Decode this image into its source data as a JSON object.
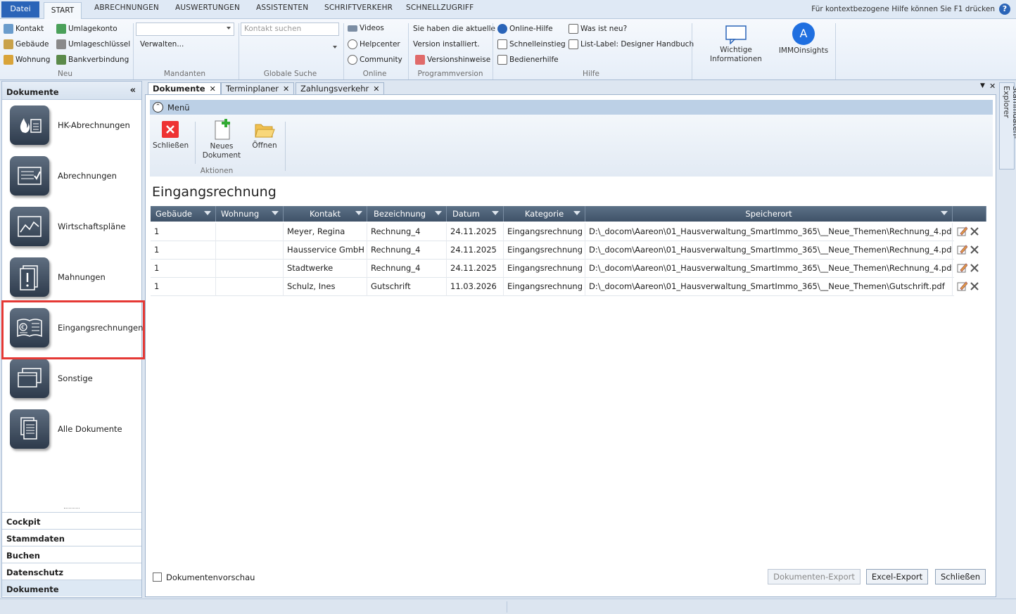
{
  "ribbon_tabs": {
    "datei": "Datei",
    "start": "START",
    "abrechnungen": "ABRECHNUNGEN",
    "auswertungen": "AUSWERTUNGEN",
    "assistenten": "ASSISTENTEN",
    "schriftverkehr": "SCHRIFTVERKEHR",
    "schnellzugriff": "SCHNELLZUGRIFF"
  },
  "help_hint": "Für kontextbezogene Hilfe können Sie F1 drücken",
  "neu": {
    "kontakt": "Kontakt",
    "gebaeude": "Gebäude",
    "wohnung": "Wohnung",
    "umlagekonto": "Umlagekonto",
    "umlageschluessel": "Umlageschlüssel",
    "bankverbindung": "Bankverbindung",
    "group": "Neu"
  },
  "mandanten": {
    "verwalten": "Verwalten...",
    "group": "Mandanten"
  },
  "suche": {
    "placeholder": "Kontakt suchen",
    "group": "Globale Suche"
  },
  "online": {
    "videos": "Videos",
    "helpcenter": "Helpcenter",
    "community": "Community",
    "group": "Online"
  },
  "programmversion": {
    "line1": "Sie haben die aktuelle",
    "line2": "Version installiert.",
    "versionshinweise": "Versionshinweise",
    "group": "Programmversion"
  },
  "hilfe": {
    "online_hilfe": "Online-Hilfe",
    "schnelleinstieg": "Schnelleinstieg",
    "bedienerhilfe": "Bedienerhilfe",
    "was_ist_neu": "Was ist neu?",
    "list_label": "List-Label: Designer Handbuch",
    "group": "Hilfe"
  },
  "info": {
    "wichtige": "Wichtige Informationen",
    "immoinsights": "IMMOinsights"
  },
  "left_panel": {
    "title": "Dokumente",
    "items": [
      {
        "label": "HK-Abrechnungen"
      },
      {
        "label": "Abrechnungen"
      },
      {
        "label": "Wirtschaftspläne"
      },
      {
        "label": "Mahnungen"
      },
      {
        "label": "Eingangsrechnungen"
      },
      {
        "label": "Sonstige"
      },
      {
        "label": "Alle Dokumente"
      }
    ],
    "sections": [
      "Cockpit",
      "Stammdaten",
      "Buchen",
      "Datenschutz",
      "Dokumente"
    ]
  },
  "doc_tabs": [
    "Dokumente",
    "Terminplaner",
    "Zahlungsverkehr"
  ],
  "menu_label": "Menü",
  "actions": {
    "schliessen": "Schließen",
    "neues1": "Neues",
    "neues2": "Dokument",
    "oeffnen": "Öffnen",
    "group": "Aktionen"
  },
  "page_title": "Eingangsrechnung",
  "table": {
    "headers": [
      "Gebäude",
      "Wohnung",
      "Kontakt",
      "Bezeichnung",
      "Datum",
      "Kategorie",
      "Speicherort"
    ],
    "rows": [
      [
        "1",
        "",
        "Meyer, Regina",
        "Rechnung_4",
        "24.11.2025",
        "Eingangsrechnung",
        "D:\\_docom\\Aareon\\01_Hausverwaltung_SmartImmo_365\\__Neue_Themen\\Rechnung_4.pdf"
      ],
      [
        "1",
        "",
        "Hausservice GmbH",
        "Rechnung_4",
        "24.11.2025",
        "Eingangsrechnung",
        "D:\\_docom\\Aareon\\01_Hausverwaltung_SmartImmo_365\\__Neue_Themen\\Rechnung_4.pdf"
      ],
      [
        "1",
        "",
        "Stadtwerke",
        "Rechnung_4",
        "24.11.2025",
        "Eingangsrechnung",
        "D:\\_docom\\Aareon\\01_Hausverwaltung_SmartImmo_365\\__Neue_Themen\\Rechnung_4.pdf"
      ],
      [
        "1",
        "",
        "Schulz, Ines",
        "Gutschrift",
        "11.03.2026",
        "Eingangsrechnung",
        "D:\\_docom\\Aareon\\01_Hausverwaltung_SmartImmo_365\\__Neue_Themen\\Gutschrift.pdf"
      ]
    ]
  },
  "preview_label": "Dokumentenvorschau",
  "buttons": {
    "export": "Dokumenten-Export",
    "excel": "Excel-Export",
    "close": "Schließen"
  },
  "explorer": "Stammdaten-Explorer",
  "immo_letter": "A"
}
